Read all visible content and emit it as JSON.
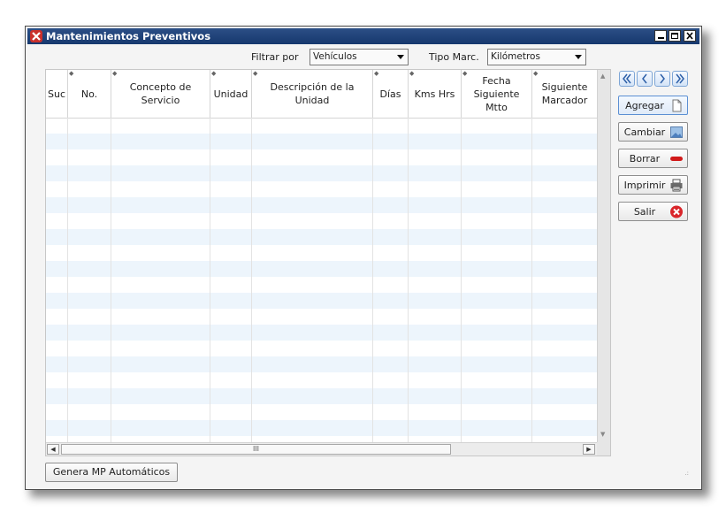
{
  "window": {
    "title": "Mantenimientos Preventivos",
    "controls": [
      "minimize-icon",
      "maximize-icon",
      "close-icon"
    ]
  },
  "filters": {
    "filter_label": "Filtrar por",
    "filter_value": "Vehículos",
    "tipo_label": "Tipo Marc.",
    "tipo_value": "Kilómetros"
  },
  "table": {
    "columns": [
      {
        "label": "Suc"
      },
      {
        "label": "No."
      },
      {
        "label": "Concepto de Servicio"
      },
      {
        "label": "Unidad"
      },
      {
        "label": "Descripción de la Unidad"
      },
      {
        "label": "Días"
      },
      {
        "label": "Kms Hrs"
      },
      {
        "label": "Fecha\nSiguiente Mtto"
      },
      {
        "label": "Siguiente\nMarcador"
      }
    ],
    "rows": [],
    "hscroll_thumb_glyph": "III"
  },
  "nav": {
    "icons": [
      "first-record-icon",
      "previous-record-icon",
      "next-record-icon",
      "last-record-icon"
    ]
  },
  "actions": {
    "agregar": "Agregar",
    "cambiar": "Cambiar",
    "borrar": "Borrar",
    "imprimir": "Imprimir",
    "salir": "Salir"
  },
  "footer": {
    "genera_label": "Genera MP Automáticos"
  },
  "colors": {
    "titlebar": "#1f4379",
    "row_alt": "#edf5fc",
    "default_button_border": "#5b8fd3",
    "delete_red": "#d11a1a"
  }
}
